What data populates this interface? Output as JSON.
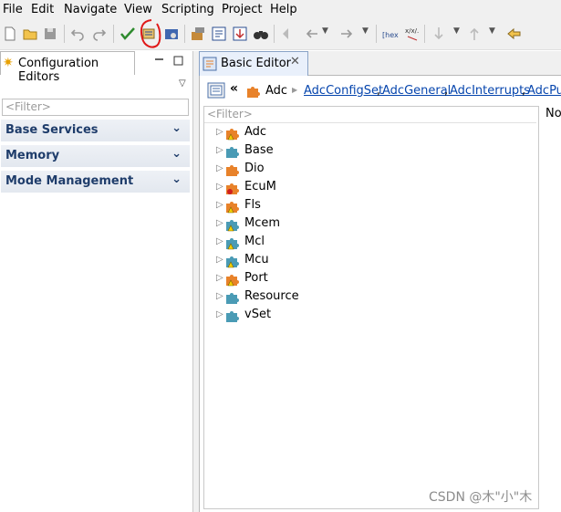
{
  "menu": [
    "File",
    "Edit",
    "Navigate",
    "View",
    "Scripting",
    "Project",
    "Help"
  ],
  "left_panel": {
    "tab_title": "Configuration Editors",
    "filter_placeholder": "<Filter>",
    "sections": [
      "Base Services",
      "Memory",
      "Mode Management"
    ]
  },
  "editor": {
    "tab_title": "Basic Editor",
    "breadcrumb_root": "Adc",
    "breadcrumb_links": [
      "AdcConfigSet",
      "AdcGeneral",
      "AdcInterrupts",
      "AdcPu"
    ],
    "filter_placeholder": "<Filter>",
    "right_clip_text": "No",
    "tree_items": [
      {
        "label": "Adc",
        "color": "orange",
        "badge": "warn"
      },
      {
        "label": "Base",
        "color": "teal",
        "badge": ""
      },
      {
        "label": "Dio",
        "color": "orange",
        "badge": ""
      },
      {
        "label": "EcuM",
        "color": "orange",
        "badge": "error"
      },
      {
        "label": "Fls",
        "color": "orange",
        "badge": "warn"
      },
      {
        "label": "Mcem",
        "color": "teal",
        "badge": "warn"
      },
      {
        "label": "Mcl",
        "color": "teal",
        "badge": "warn"
      },
      {
        "label": "Mcu",
        "color": "teal",
        "badge": "warn"
      },
      {
        "label": "Port",
        "color": "orange",
        "badge": "warn"
      },
      {
        "label": "Resource",
        "color": "teal",
        "badge": ""
      },
      {
        "label": "vSet",
        "color": "teal",
        "badge": ""
      }
    ]
  },
  "toolbar_icons": [
    "new-icon",
    "open-icon",
    "save-icon",
    "undo-icon",
    "redo-icon",
    "validate-icon",
    "generate-icon",
    "settings-icon",
    "build-icon",
    "properties-icon",
    "export-icon",
    "find-icon",
    "back-icon",
    "nav-back-icon",
    "nav-forward-icon",
    "hex-icon",
    "xml-icon",
    "down-icon",
    "up-icon",
    "link-icon"
  ],
  "colors": {
    "orange": "#e8822a",
    "teal": "#4a9bb5",
    "link": "#0645ad",
    "section_text": "#1f3d6b"
  },
  "watermark": "CSDN @木\"小\"木"
}
